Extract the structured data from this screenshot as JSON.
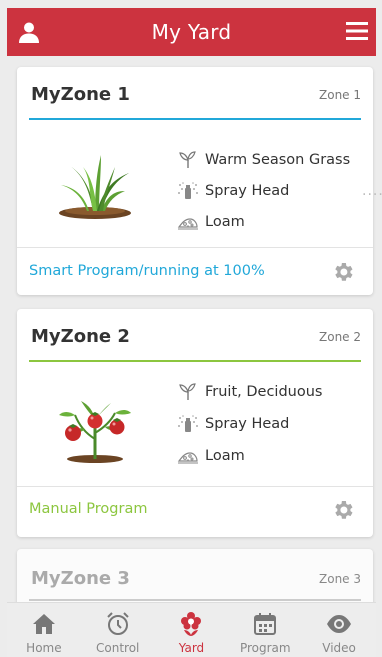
{
  "header": {
    "title": "My Yard",
    "left_icon": "user-icon",
    "right_icon": "hamburger-menu-icon",
    "color": "#cc333f"
  },
  "zones": [
    {
      "name": "MyZone 1",
      "zone_label": "Zone 1",
      "accent": "#21a8d9",
      "plant_icon": "grass-icon",
      "attributes": [
        {
          "icon": "sprout-icon",
          "label": "Warm Season Grass"
        },
        {
          "icon": "sprinkler-icon",
          "label": "Spray Head"
        },
        {
          "icon": "soil-icon",
          "label": "Loam"
        }
      ],
      "program": "Smart Program/running at 100%",
      "program_color": "#21a8d9"
    },
    {
      "name": "MyZone 2",
      "zone_label": "Zone 2",
      "accent": "#8cc63f",
      "plant_icon": "tomato-plant-icon",
      "attributes": [
        {
          "icon": "sprout-icon",
          "label": "Fruit, Deciduous"
        },
        {
          "icon": "sprinkler-icon",
          "label": "Spray Head"
        },
        {
          "icon": "soil-icon",
          "label": "Loam"
        }
      ],
      "program": "Manual Program",
      "program_color": "#8cc63f"
    },
    {
      "name": "MyZone 3",
      "zone_label": "Zone 3"
    }
  ],
  "tabs": [
    {
      "label": "Home",
      "icon": "home-icon",
      "active": false
    },
    {
      "label": "Control",
      "icon": "alarm-clock-icon",
      "active": false
    },
    {
      "label": "Yard",
      "icon": "flower-icon",
      "active": true
    },
    {
      "label": "Program",
      "icon": "calendar-icon",
      "active": false
    },
    {
      "label": "Video",
      "icon": "eye-icon",
      "active": false
    }
  ]
}
